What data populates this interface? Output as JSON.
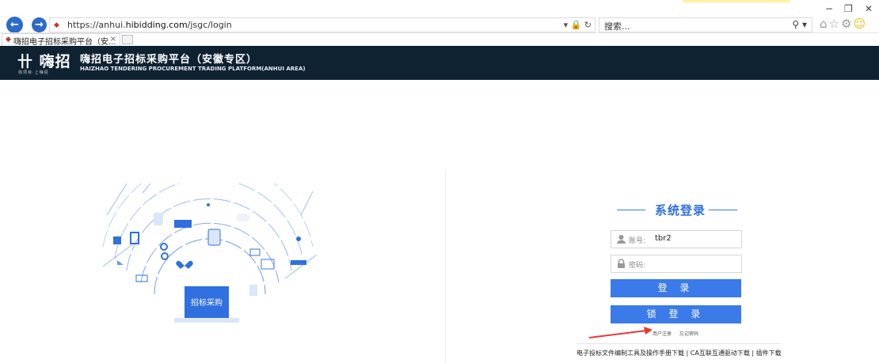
{
  "browser": {
    "url_prefix": "https://anhui.",
    "url_domain": "hibidding.com",
    "url_path": "/jsgc/login",
    "search_placeholder": "搜索...",
    "tab_title": "嗨招电子招标采购平台（安...",
    "addr_controls": "▾ 🔒 ↻",
    "minimize": "−",
    "restore": "❐",
    "close": "✕"
  },
  "header": {
    "logo_text": "卄 嗨招",
    "logo_tagline": "找项目·上嗨招",
    "title": "嗨招电子招标采购平台（安徽专区）",
    "subtitle": "HAIZHAO TENDERING PROCUREMENT TRADING PLATFORM(ANHUI AREA)"
  },
  "illustration": {
    "label": "招标采购"
  },
  "login": {
    "title": "系统登录",
    "account_label": "账号:",
    "account_value": "tbr2",
    "password_label": "密码:",
    "login_button": "登 录",
    "lock_login_button": "锁 登 录",
    "register_link": "用户注册",
    "forgot_link": "忘记密码",
    "downloads_text": "电子投标文件编制工具及操作手册下载 | CA互联互通驱动下载 | 插件下载"
  },
  "colors": {
    "header_bg": "#0f2232",
    "accent": "#3b7be9",
    "arrow": "#e53935"
  }
}
